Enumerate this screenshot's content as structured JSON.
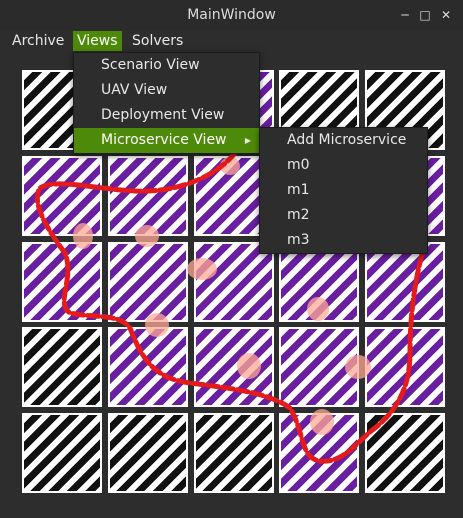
{
  "window": {
    "title": "MainWindow"
  },
  "titlebar_buttons": {
    "minimize": "─",
    "maximize": "□",
    "close": "✕"
  },
  "menubar": {
    "items": [
      "Archive",
      "Views",
      "Solvers"
    ]
  },
  "views_menu": {
    "items": [
      "Scenario View",
      "UAV View",
      "Deployment View",
      "Microservice View"
    ]
  },
  "microservice_menu": {
    "items": [
      "Add Microservice",
      "m0",
      "m1",
      "m2",
      "m3"
    ]
  },
  "colors": {
    "accent": "#4e8a0a",
    "route": "#e41a1c",
    "purple": "#6a1ea0",
    "black": "#111111"
  }
}
